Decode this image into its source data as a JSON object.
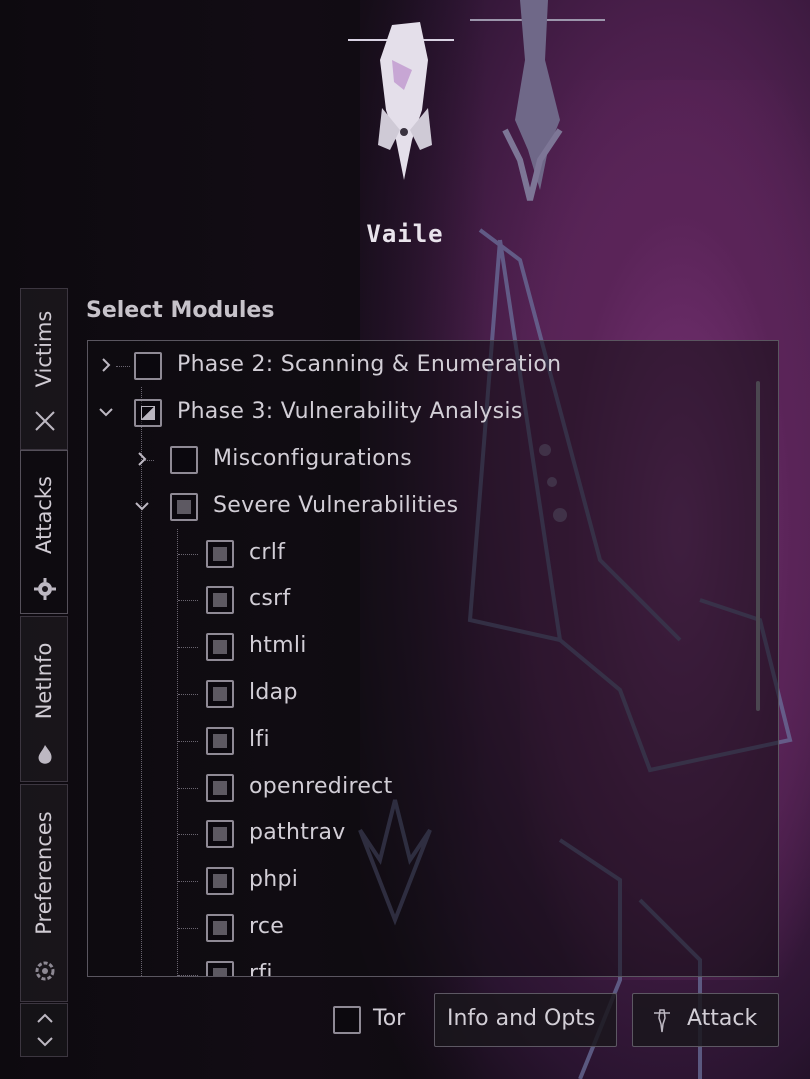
{
  "app": {
    "logo_text": "Vaile"
  },
  "tabs": [
    {
      "label": "Victims",
      "icon": "crossed-swords-icon",
      "active": false
    },
    {
      "label": "Attacks",
      "icon": "gear-icon",
      "active": true
    },
    {
      "label": "NetInfo",
      "icon": "flame-icon",
      "active": false
    },
    {
      "label": "Preferences",
      "icon": "settings-icon",
      "active": false
    }
  ],
  "panel": {
    "title": "Select Modules"
  },
  "tree": {
    "phase2": {
      "label": "Phase 2: Scanning & Enumeration",
      "expanded": false,
      "state": "unchecked"
    },
    "phase3": {
      "label": "Phase 3: Vulnerability Analysis",
      "expanded": true,
      "state": "partial"
    },
    "misconfig": {
      "label": "Misconfigurations",
      "expanded": false,
      "state": "unchecked"
    },
    "severe": {
      "label": "Severe Vulnerabilities",
      "expanded": true,
      "state": "checked"
    },
    "modules": [
      "crlf",
      "csrf",
      "htmli",
      "ldap",
      "lfi",
      "openredirect",
      "pathtrav",
      "phpi",
      "rce",
      "rfi"
    ]
  },
  "footer": {
    "tor_label": "Tor",
    "tor_checked": false,
    "info_button": "Info and Opts",
    "attack_button": "Attack"
  },
  "colors": {
    "background": "#0f0b11",
    "accent": "#6a2c68",
    "text": "#d2ced6"
  }
}
